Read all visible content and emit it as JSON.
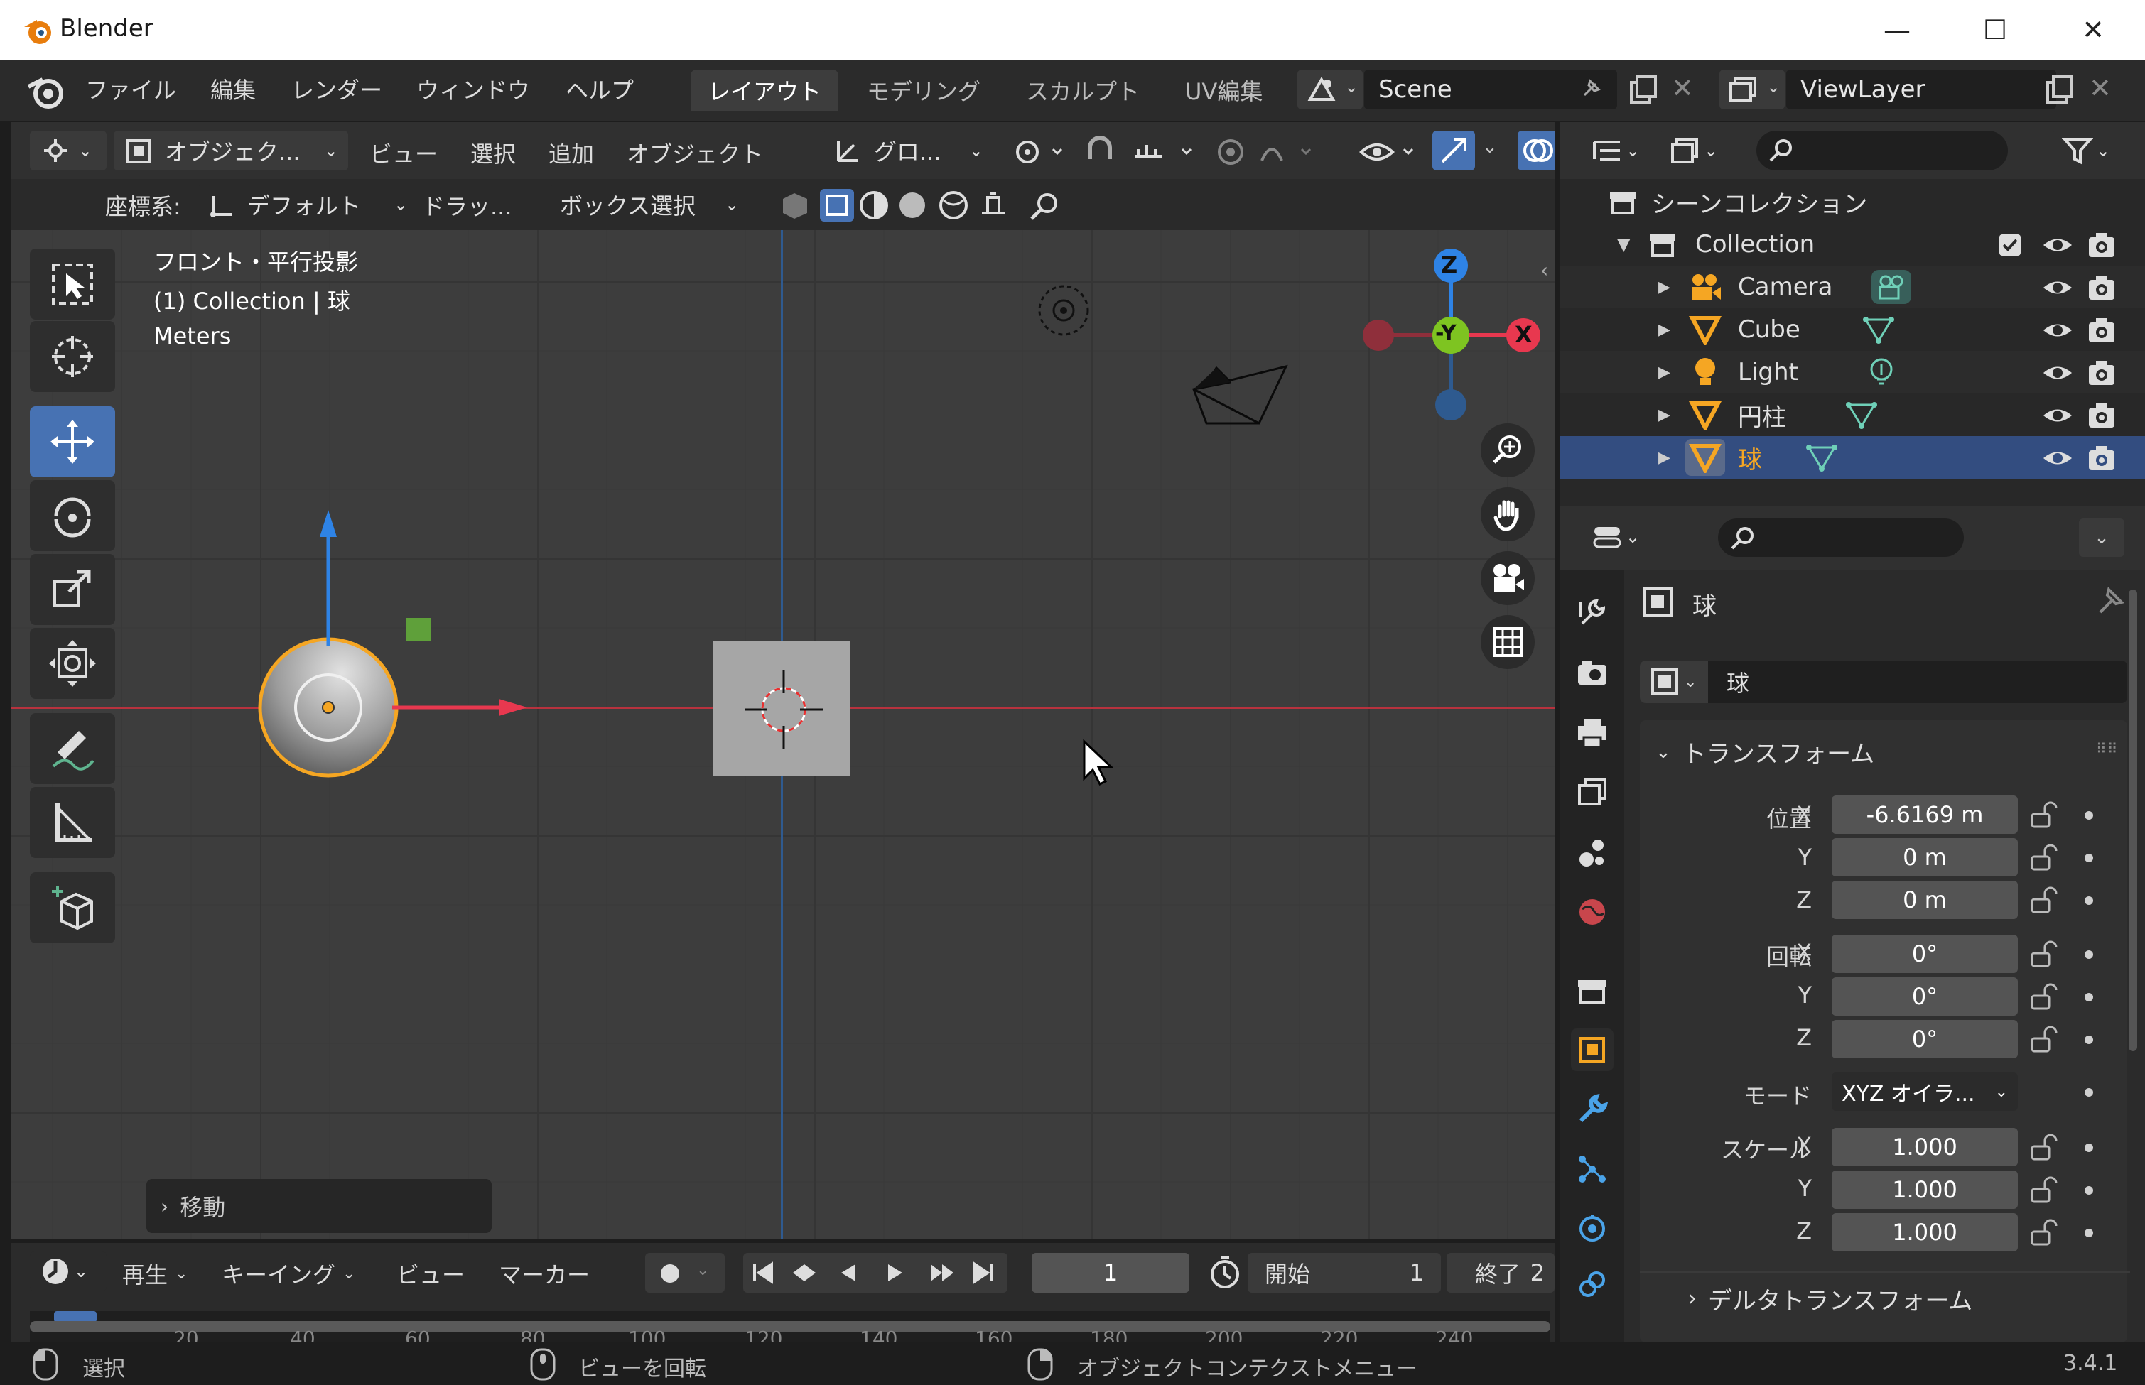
{
  "window": {
    "title": "Blender",
    "minimize": "—",
    "maximize": "☐",
    "close": "✕"
  },
  "topbar": {
    "menus": [
      "ファイル",
      "編集",
      "レンダー",
      "ウィンドウ",
      "ヘルプ"
    ],
    "workspaces": [
      "レイアウト",
      "モデリング",
      "スカルプト",
      "UV編集"
    ],
    "active_workspace": "レイアウト",
    "scene": "Scene",
    "view_layer": "ViewLayer"
  },
  "viewport_header": {
    "mode": "オブジェク...",
    "menus": [
      "ビュー",
      "選択",
      "追加",
      "オブジェクト"
    ],
    "transform_orientation": "グロ...",
    "coord_label": "座標系:",
    "coord_value": "デフォルト",
    "drag_label": "ドラッ...",
    "select_mode": "ボックス選択"
  },
  "viewport": {
    "view_name": "フロント・平行投影",
    "collection_info": "(1) Collection | 球",
    "units": "Meters",
    "gizmo": {
      "z": "Z",
      "y": "-Y",
      "x": "X"
    },
    "last_operator": "移動"
  },
  "timeline": {
    "playback": "再生",
    "keying": "キーイング",
    "view": "ビュー",
    "marker": "マーカー",
    "current_frame": "1",
    "start_label": "開始",
    "start_value": "1",
    "end_label": "終了",
    "end_value": "2",
    "ruler_ticks": [
      "20",
      "40",
      "60",
      "80",
      "100",
      "120",
      "140",
      "160",
      "180",
      "200",
      "220",
      "240"
    ]
  },
  "status": {
    "select": "選択",
    "rotate_view": "ビューを回転",
    "context_menu": "オブジェクトコンテクストメニュー",
    "version": "3.4.1"
  },
  "outliner": {
    "root": "シーンコレクション",
    "collection": "Collection",
    "items": [
      {
        "name": "Camera",
        "type": "camera"
      },
      {
        "name": "Cube",
        "type": "mesh"
      },
      {
        "name": "Light",
        "type": "light"
      },
      {
        "name": "円柱",
        "type": "mesh"
      },
      {
        "name": "球",
        "type": "mesh",
        "selected": true
      }
    ]
  },
  "properties": {
    "object_name": "球",
    "data_name": "球",
    "panel_transform": "トランスフォーム",
    "location_label": "位置",
    "rotation_label": "回転",
    "scale_label": "スケール",
    "mode_label": "モード",
    "axis_x": "X",
    "axis_y": "Y",
    "axis_z": "Z",
    "location": [
      "-6.6169 m",
      "0 m",
      "0 m"
    ],
    "rotation": [
      "0°",
      "0°",
      "0°"
    ],
    "rotation_mode": "XYZ オイラ...",
    "scale": [
      "1.000",
      "1.000",
      "1.000"
    ],
    "panel_delta": "デルタトランスフォーム"
  },
  "colors": {
    "accent": "#4772b3",
    "selection": "#f5a623",
    "x_axis": "#e8384f",
    "y_axis": "#7ec421",
    "z_axis": "#2e83e6"
  }
}
